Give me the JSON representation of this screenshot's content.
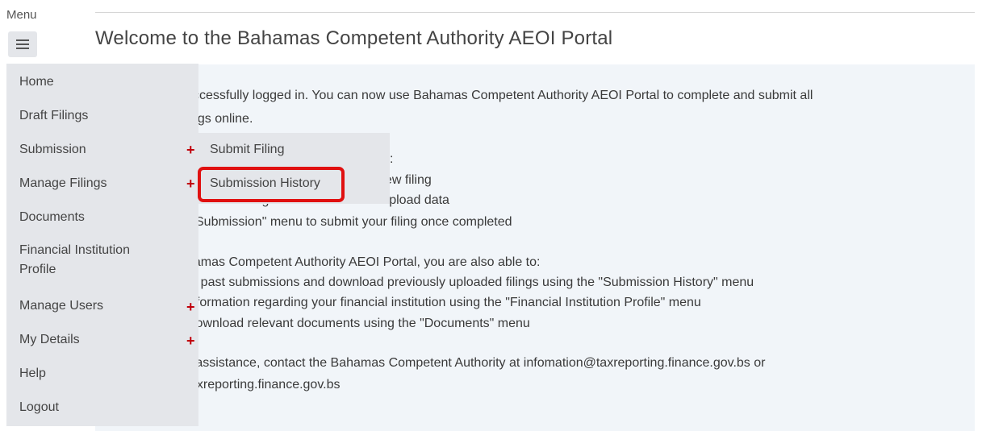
{
  "menu_label": "Menu",
  "page_title": "Welcome to the Bahamas Competent Authority AEOI Portal",
  "sidebar": {
    "items": [
      {
        "label": "Home",
        "has_submenu": false
      },
      {
        "label": "Draft Filings",
        "has_submenu": false
      },
      {
        "label": "Submission",
        "has_submenu": true
      },
      {
        "label": "Manage Filings",
        "has_submenu": true
      },
      {
        "label": "Documents",
        "has_submenu": false
      },
      {
        "label_line1": "Financial Institution",
        "label_line2": "Profile",
        "has_submenu": false
      },
      {
        "label": "Manage Users",
        "has_submenu": true
      },
      {
        "label": "My Details",
        "has_submenu": true
      },
      {
        "label": "Help",
        "has_submenu": false
      },
      {
        "label": "Logout",
        "has_submenu": false
      }
    ]
  },
  "submenu": {
    "parent": "Submission",
    "items": [
      {
        "label": "Submit Filing"
      },
      {
        "label": "Submission History",
        "highlighted": true
      }
    ]
  },
  "content": {
    "lines": [
      "ccessfully logged in. You can now use Bahamas Competent Authority AEOI Portal to complete and submit all",
      "ngs online.",
      ":",
      "ate a new filing",
      "Draft Filings\" menu to enter or upload data",
      "Submission\" menu to submit your filing once completed",
      "hamas Competent Authority AEOI Portal, you are also able to:",
      "ur past submissions and download previously uploaded filings using the \"Submission History\" menu",
      "nformation regarding your financial institution using the \"Financial Institution Profile\" menu",
      "lownload relevant documents using the \"Documents\" menu",
      "e assistance, contact the Bahamas Competent Authority at infomation@taxreporting.finance.gov.bs or",
      "axreporting.finance.gov.bs"
    ]
  },
  "colors": {
    "menu_bg": "#e4e6ea",
    "content_bg": "#f1f5f9",
    "plus_red": "#c0000a",
    "highlight_red": "#e01010"
  },
  "icons": {
    "menu_toggle": "hamburger-icon",
    "expand": "plus-icon"
  }
}
